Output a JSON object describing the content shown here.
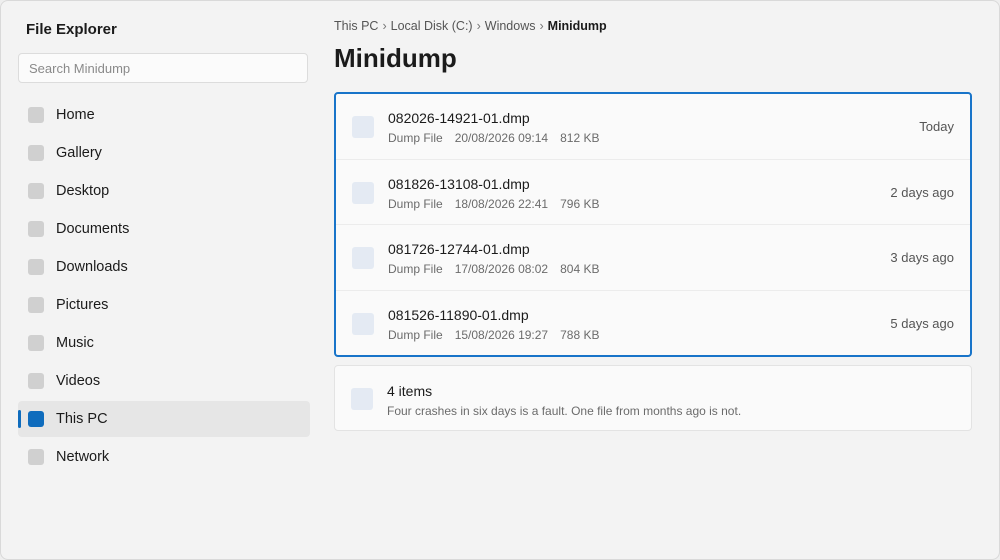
{
  "app": {
    "title": "File Explorer"
  },
  "search": {
    "placeholder": "Search Minidump"
  },
  "sidebar": {
    "items": [
      {
        "label": "Home",
        "active": false
      },
      {
        "label": "Gallery",
        "active": false
      },
      {
        "label": "Desktop",
        "active": false
      },
      {
        "label": "Documents",
        "active": false
      },
      {
        "label": "Downloads",
        "active": false
      },
      {
        "label": "Pictures",
        "active": false
      },
      {
        "label": "Music",
        "active": false
      },
      {
        "label": "Videos",
        "active": false
      },
      {
        "label": "This PC",
        "active": true
      },
      {
        "label": "Network",
        "active": false
      }
    ]
  },
  "breadcrumb": {
    "items": [
      "This PC",
      "Local Disk (C:)",
      "Windows"
    ],
    "separator": "›",
    "current": "Minidump"
  },
  "page": {
    "title": "Minidump"
  },
  "files": [
    {
      "name": "082026-14921-01.dmp",
      "type": "Dump File",
      "modified": "20/08/2026 09:14",
      "size": "812 KB",
      "age": "Today"
    },
    {
      "name": "081826-13108-01.dmp",
      "type": "Dump File",
      "modified": "18/08/2026 22:41",
      "size": "796 KB",
      "age": "2 days ago"
    },
    {
      "name": "081726-12744-01.dmp",
      "type": "Dump File",
      "modified": "17/08/2026 08:02",
      "size": "804 KB",
      "age": "3 days ago"
    },
    {
      "name": "081526-11890-01.dmp",
      "type": "Dump File",
      "modified": "15/08/2026 19:27",
      "size": "788 KB",
      "age": "5 days ago"
    }
  ],
  "summary": {
    "count": "4 items",
    "note": "Four crashes in six days is a fault. One file from months ago is not."
  },
  "colors": {
    "accent": "#0f6cbd",
    "selection_border": "#1874c9",
    "background": "#f3f3f3",
    "file_icon": "#e4eaf3"
  }
}
